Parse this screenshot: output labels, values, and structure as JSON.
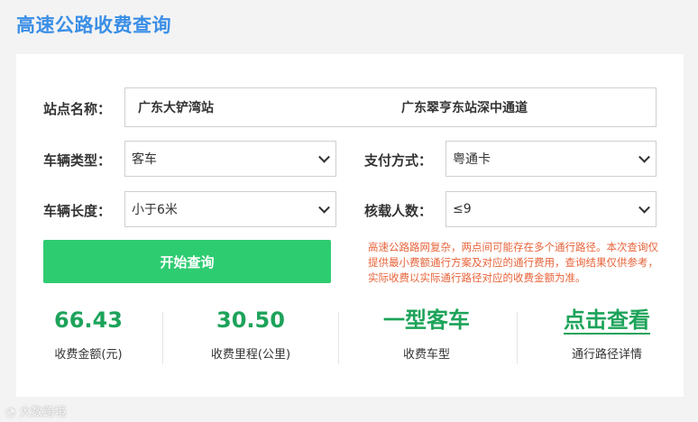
{
  "page_title": "高速公路收费查询",
  "form": {
    "station_label": "站点名称：",
    "station_from": "广东大铲湾站",
    "station_to": "广东翠亨东站深中通道",
    "vehicle_type_label": "车辆类型：",
    "vehicle_type_value": "客车",
    "payment_label": "支付方式：",
    "payment_value": "粤通卡",
    "vehicle_length_label": "车辆长度：",
    "vehicle_length_value": "小于6米",
    "capacity_label": "核载人数：",
    "capacity_value": "≤9",
    "query_button": "开始查询",
    "notice": "高速公路路网复杂，两点间可能存在多个通行路径。本次查询仅提供最小费额通行方案及对应的通行费用，查询结果仅供参考，实际收费以实际通行路径对应的收费金额为准。"
  },
  "results": {
    "fee_value": "66.43",
    "fee_label": "收费金额(元)",
    "distance_value": "30.50",
    "distance_label": "收费里程(公里)",
    "vehicle_class_value": "一型客车",
    "vehicle_class_label": "收费车型",
    "detail_link": "点击查看",
    "detail_label": "通行路径详情"
  },
  "watermark": "大数跨境",
  "colors": {
    "title": "#3a8ee6",
    "accent_green": "#2ecc71",
    "value_green": "#1da35a",
    "notice_orange": "#e8633a"
  }
}
